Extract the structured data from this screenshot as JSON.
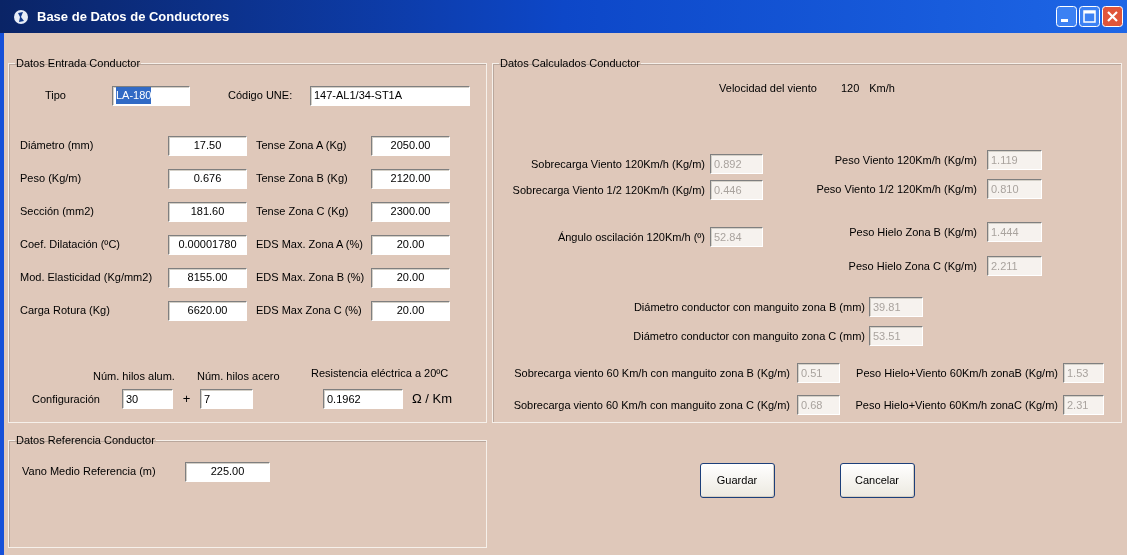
{
  "window": {
    "title": "Base de Datos de Conductores"
  },
  "input_group": {
    "title": "Datos Entrada Conductor",
    "tipo": {
      "label": "Tipo",
      "value": "LA-180",
      "text_selected": true
    },
    "codigo": {
      "label": "Código UNE:",
      "value": "147-AL1/34-ST1A",
      "text_selected": false
    },
    "rows": [
      {
        "label": "Diámetro (mm)",
        "value": "17.50",
        "label_2": "Tense Zona A (Kg)",
        "value_2": "2050.00"
      },
      {
        "label": "Peso (Kg/m)",
        "value": "0.676",
        "label_2": "Tense Zona B (Kg)",
        "value_2": "2120.00"
      },
      {
        "label": "Sección (mm2)",
        "value": "181.60",
        "label_2": "Tense Zona C (Kg)",
        "value_2": "2300.00"
      },
      {
        "label": "Coef. Dilatación (ºC)",
        "value": "0.00001780",
        "label_2": "EDS Max. Zona A (%)",
        "value_2": "20.00"
      },
      {
        "label": "Mod. Elasticidad (Kg/mm2)",
        "value": "8155.00",
        "label_2": "EDS Max. Zona B (%)",
        "value_2": "20.00"
      },
      {
        "label": "Carga Rotura (Kg)",
        "value": "6620.00",
        "label_2": "EDS Max Zona C (%)",
        "value_2": "20.00"
      }
    ],
    "configuration": {
      "label": "Configuración",
      "aluminium_header": "Núm. hilos alum.",
      "aluminium_value": "30",
      "plus": "+",
      "steel_header": "Núm. hilos acero",
      "steel_value": "7",
      "resistance_header": "Resistencia eléctrica a 20ºC",
      "resistance_value": "0.1962",
      "resistance_unit": "Ω / Km"
    }
  },
  "calculated_group": {
    "title": "Datos Calculados Conductor",
    "wind_speed": {
      "label": "Velocidad del viento",
      "value": "120",
      "unit": "Km/h"
    },
    "left_column": [
      {
        "label": "Sobrecarga Viento 120Km/h (Kg/m)",
        "value": "0.892",
        "disabled": true
      },
      {
        "label": "Sobrecarga Viento 1/2 120Km/h (Kg/m)",
        "value": "0.446",
        "disabled": true
      },
      {
        "label": "Ángulo oscilación 120Km/h (º)",
        "value": "52.84",
        "disabled": true
      }
    ],
    "right_column": [
      {
        "label": "Peso Viento 120Km/h (Kg/m)",
        "value": "1.119",
        "disabled": true
      },
      {
        "label": "Peso Viento 1/2 120Km/h (Kg/m)",
        "value": "0.810",
        "disabled": true
      },
      {
        "label": "Peso Hielo Zona B (Kg/m)",
        "value": "1.444",
        "disabled": true
      },
      {
        "label": "Peso Hielo Zona C (Kg/m)",
        "value": "2.211",
        "disabled": true
      }
    ],
    "diameter_rows": [
      {
        "label": "Diámetro conductor con manguito zona B (mm)",
        "value": "39.81",
        "disabled": true
      },
      {
        "label": "Diámetro conductor con manguito zona C (mm)",
        "value": "53.51",
        "disabled": true
      }
    ],
    "sleeve_rows": [
      {
        "label": "Sobrecarga viento 60 Km/h con manguito zona B (Kg/m)",
        "value": "0.51",
        "label_2": "Peso Hielo+Viento 60Km/h zonaB (Kg/m)",
        "value_2": "1.53",
        "disabled": true
      },
      {
        "label": "Sobrecarga viento 60 Km/h con manguito zona C (Kg/m)",
        "value": "0.68",
        "label_2": "Peso Hielo+Viento 60Km/h zonaC (Kg/m)",
        "value_2": "2.31",
        "disabled": true
      }
    ]
  },
  "reference_group": {
    "title": "Datos Referencia Conductor",
    "label": "Vano Medio Referencia (m)",
    "value": "225.00"
  },
  "buttons": [
    "Guardar",
    "Cancelar"
  ]
}
